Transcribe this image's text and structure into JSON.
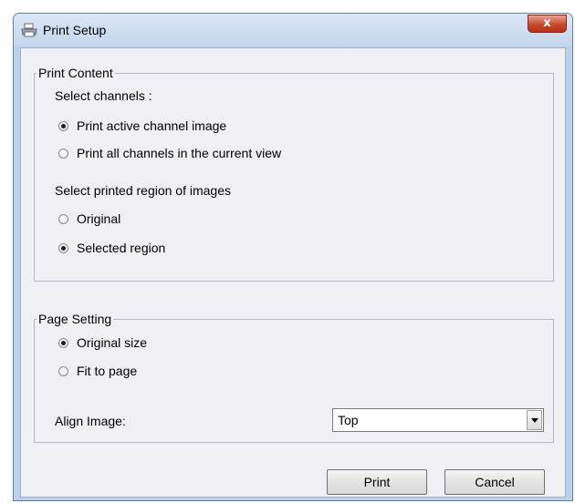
{
  "window": {
    "title": "Print Setup",
    "close_label": "x"
  },
  "print_content": {
    "legend": "Print Content",
    "channels_label": "Select channels :",
    "channel_options": [
      {
        "label": "Print active channel image",
        "selected": true
      },
      {
        "label": "Print all channels in the current view",
        "selected": false
      }
    ],
    "region_label": "Select printed region of images",
    "region_options": [
      {
        "label": "Original",
        "selected": false
      },
      {
        "label": "Selected region",
        "selected": true
      }
    ]
  },
  "page_setting": {
    "legend": "Page Setting",
    "size_options": [
      {
        "label": "Original size",
        "selected": true
      },
      {
        "label": "Fit to page",
        "selected": false
      }
    ],
    "align_label": "Align Image:",
    "align_value": "Top"
  },
  "buttons": {
    "print": "Print",
    "cancel": "Cancel"
  }
}
